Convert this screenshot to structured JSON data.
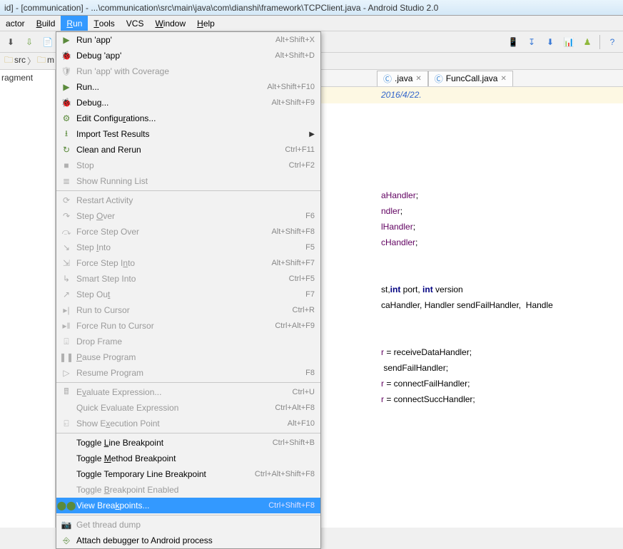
{
  "title": "id] - [communication] - ...\\communication\\src\\main\\java\\com\\dianshi\\framework\\TCPClient.java - Android Studio 2.0",
  "menubar": [
    "actor",
    "Build",
    "Run",
    "Tools",
    "VCS",
    "Window",
    "Help"
  ],
  "menubar_underline_idx": [
    -1,
    0,
    0,
    0,
    -1,
    0,
    0
  ],
  "menubar_active_index": 2,
  "breadcrumb_items": [
    "src",
    "m"
  ],
  "sidebar_label": "ragment",
  "tabs": [
    {
      "label": ".java",
      "ficon": "C"
    },
    {
      "label": "FuncCall.java",
      "ficon": "C"
    }
  ],
  "comment_prefix": "",
  "comment_date": "2016/4/22.",
  "code_lines": [
    {
      "frag": [
        {
          "t": "aHandler",
          "c": "ident"
        },
        {
          "t": ";",
          "c": ""
        }
      ]
    },
    {
      "frag": [
        {
          "t": "ndler",
          "c": "ident"
        },
        {
          "t": ";",
          "c": ""
        }
      ]
    },
    {
      "frag": [
        {
          "t": "lHandler",
          "c": "ident"
        },
        {
          "t": ";",
          "c": ""
        }
      ]
    },
    {
      "frag": [
        {
          "t": "cHandler",
          "c": "ident"
        },
        {
          "t": ";",
          "c": ""
        }
      ]
    },
    {
      "frag": []
    },
    {
      "frag": []
    },
    {
      "frag": [
        {
          "t": "st,",
          "c": ""
        },
        {
          "t": "int",
          "c": "kw"
        },
        {
          "t": " port, ",
          "c": ""
        },
        {
          "t": "int",
          "c": "kw"
        },
        {
          "t": " version",
          "c": ""
        }
      ]
    },
    {
      "frag": [
        {
          "t": "caHandler, Handler sendFailHandler,  Handle",
          "c": ""
        }
      ]
    },
    {
      "frag": []
    },
    {
      "frag": []
    },
    {
      "frag": [
        {
          "t": "r",
          "c": "ident"
        },
        {
          "t": " = receiveDataHandler;",
          "c": ""
        }
      ]
    },
    {
      "frag": [
        {
          "t": " sendFailHandler;",
          "c": ""
        }
      ]
    },
    {
      "frag": [
        {
          "t": "r",
          "c": "ident"
        },
        {
          "t": " = connectFailHandler;",
          "c": ""
        }
      ]
    },
    {
      "frag": [
        {
          "t": "r",
          "c": "ident"
        },
        {
          "t": " = connectSuccHandler;",
          "c": ""
        }
      ]
    }
  ],
  "dropdown": [
    {
      "type": "item",
      "icon": "play",
      "label": "Run 'app'",
      "shortcut": "Alt+Shift+X"
    },
    {
      "type": "item",
      "icon": "bug",
      "label": "Debug 'app'",
      "shortcut": "Alt+Shift+D"
    },
    {
      "type": "item",
      "icon": "shield",
      "label": "Run 'app' with Coverage",
      "disabled": true
    },
    {
      "type": "item",
      "icon": "play",
      "label": "Run...",
      "shortcut": "Alt+Shift+F10"
    },
    {
      "type": "item",
      "icon": "bug",
      "label": "Debug...",
      "shortcut": "Alt+Shift+F9"
    },
    {
      "type": "item",
      "icon": "gear",
      "label": "Edit Configu_rations..."
    },
    {
      "type": "item",
      "icon": "import",
      "label": "Import Test Results",
      "submenu": true
    },
    {
      "type": "item",
      "icon": "rerun",
      "label": "Clean and Rerun",
      "shortcut": "Ctrl+F11"
    },
    {
      "type": "item",
      "icon": "stop",
      "label": "Stop",
      "shortcut": "Ctrl+F2",
      "disabled": true
    },
    {
      "type": "item",
      "icon": "list",
      "label": "Show Running List",
      "disabled": true
    },
    {
      "type": "sep"
    },
    {
      "type": "item",
      "icon": "restart",
      "label": "Restart Activity",
      "disabled": true
    },
    {
      "type": "item",
      "icon": "stepover",
      "label": "Step _Over",
      "shortcut": "F6",
      "disabled": true
    },
    {
      "type": "item",
      "icon": "forceover",
      "label": "Force Step Over",
      "shortcut": "Alt+Shift+F8",
      "disabled": true
    },
    {
      "type": "item",
      "icon": "stepinto",
      "label": "Step _Into",
      "shortcut": "F5",
      "disabled": true
    },
    {
      "type": "item",
      "icon": "forceinto",
      "label": "Force Step I_nto",
      "shortcut": "Alt+Shift+F7",
      "disabled": true
    },
    {
      "type": "item",
      "icon": "smartinto",
      "label": "Smart Step Into",
      "shortcut": "Ctrl+F5",
      "disabled": true
    },
    {
      "type": "item",
      "icon": "stepout",
      "label": "Step Ou_t",
      "shortcut": "F7",
      "disabled": true
    },
    {
      "type": "item",
      "icon": "runcursor",
      "label": "Run to Cursor",
      "shortcut": "Ctrl+R",
      "disabled": true
    },
    {
      "type": "item",
      "icon": "forcecursor",
      "label": "Force Run to Cursor",
      "shortcut": "Ctrl+Alt+F9",
      "disabled": true
    },
    {
      "type": "item",
      "icon": "dropframe",
      "label": "Drop Frame",
      "disabled": true
    },
    {
      "type": "item",
      "icon": "pause",
      "label": "_Pause Program",
      "disabled": true
    },
    {
      "type": "item",
      "icon": "resume",
      "label": "Resume Program",
      "shortcut": "F8",
      "disabled": true
    },
    {
      "type": "sep"
    },
    {
      "type": "item",
      "icon": "calc",
      "label": "E_valuate Expression...",
      "shortcut": "Ctrl+U",
      "disabled": true
    },
    {
      "type": "item",
      "icon": "",
      "label": "Quick Evaluate Expression",
      "shortcut": "Ctrl+Alt+F8",
      "disabled": true
    },
    {
      "type": "item",
      "icon": "showexec",
      "label": "Show E_xecution Point",
      "shortcut": "Alt+F10",
      "disabled": true
    },
    {
      "type": "sep"
    },
    {
      "type": "item",
      "icon": "",
      "label": "Toggle _Line Breakpoint",
      "shortcut": "Ctrl+Shift+B"
    },
    {
      "type": "item",
      "icon": "",
      "label": "Toggle _Method Breakpoint"
    },
    {
      "type": "item",
      "icon": "",
      "label": "Toggle Temporary Line Breakpoint",
      "shortcut": "Ctrl+Alt+Shift+F8"
    },
    {
      "type": "item",
      "icon": "",
      "label": "Toggle _Breakpoint Enabled",
      "disabled": true
    },
    {
      "type": "item",
      "icon": "breakpoints",
      "label": "View Brea_kpoints...",
      "shortcut": "Ctrl+Shift+F8",
      "selected": true
    },
    {
      "type": "sep"
    },
    {
      "type": "item",
      "icon": "camera",
      "label": "Get thread dump",
      "disabled": true
    },
    {
      "type": "item",
      "icon": "attach",
      "label": "Attach debugger to Android process"
    }
  ]
}
